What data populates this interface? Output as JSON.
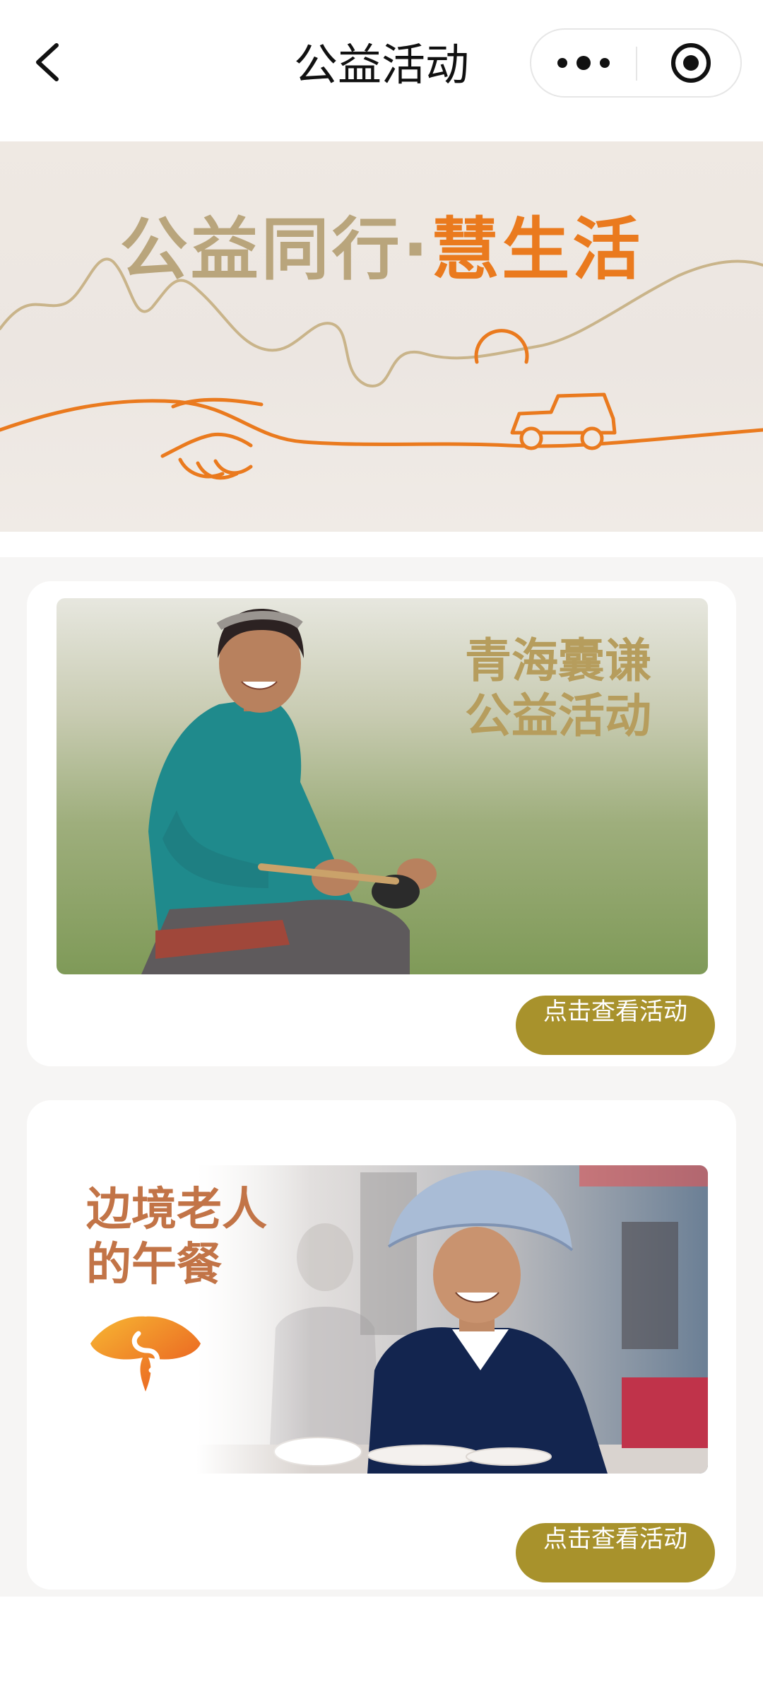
{
  "nav": {
    "title": "公益活动",
    "back_icon": "chevron-left-icon",
    "more_icon": "more-dots-icon",
    "close_icon": "target-circle-icon"
  },
  "banner": {
    "title_part1": "公益同行·",
    "title_part2": "慧生活",
    "colors": {
      "gold": "#b9a57c",
      "orange": "#ea7a1e"
    }
  },
  "activities": [
    {
      "title_line1": "青海囊谦",
      "title_line2": "公益活动",
      "button_label": "点击查看活动"
    },
    {
      "title_line1": "边境老人",
      "title_line2": "的午餐",
      "button_label": "点击查看活动"
    }
  ],
  "colors": {
    "button": "#a8922c",
    "page_bg": "#f6f5f4"
  }
}
